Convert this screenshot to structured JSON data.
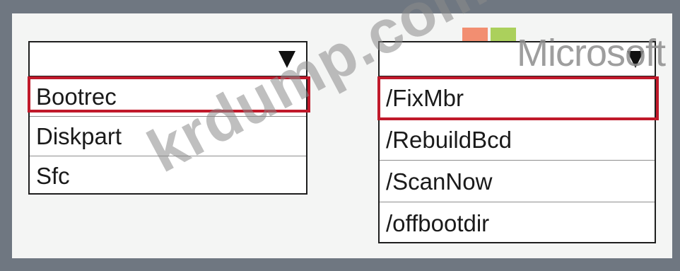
{
  "dropdowns": {
    "command": {
      "value": "",
      "options": [
        "Bootrec",
        "Diskpart",
        "Sfc"
      ],
      "selected": "Bootrec"
    },
    "switch": {
      "value": "",
      "options": [
        "/FixMbr",
        "/RebuildBcd",
        "/ScanNow",
        "/offbootdir"
      ],
      "selected": "/FixMbr"
    }
  },
  "watermarks": {
    "site": "krdump.com",
    "brand": "Microsoft"
  },
  "colors": {
    "selection_outline": "#c0192a",
    "frame": "#6f7781",
    "panel": "#f4f5f4"
  },
  "icons": {
    "dropdown_arrow": "triangle-down"
  }
}
